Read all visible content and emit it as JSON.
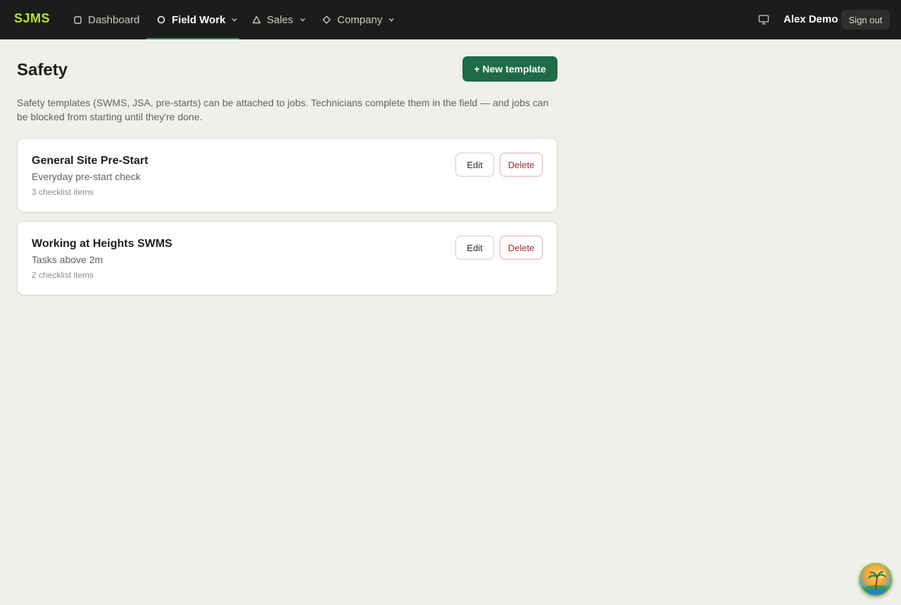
{
  "nav": {
    "brand": "SJMS",
    "items": [
      {
        "label": "Dashboard",
        "icon": "square-icon"
      },
      {
        "label": "Field Work",
        "icon": "circle-icon",
        "active": true
      },
      {
        "label": "Sales",
        "icon": "triangle-icon"
      },
      {
        "label": "Company",
        "icon": "diamond-icon"
      }
    ],
    "user_name": "Alex Demo",
    "sign_out": "Sign out",
    "monitor_icon": "monitor-icon"
  },
  "page": {
    "title": "Safety",
    "new_button": "+ New template",
    "intro": "Safety templates (SWMS, JSA, pre-starts) can be attached to jobs. Technicians complete them in the field — and jobs can be blocked from starting until they're done."
  },
  "templates": [
    {
      "title": "General Site Pre-Start",
      "subtitle": "Everyday pre-start check",
      "meta": "3 checklist items",
      "edit": "Edit",
      "delete": "Delete"
    },
    {
      "title": "Working at Heights SWMS",
      "subtitle": "Tasks above 2m",
      "meta": "2 checklist items",
      "edit": "Edit",
      "delete": "Delete"
    }
  ],
  "colors": {
    "brand": "#b9e33a",
    "primary_button": "#1e6b45",
    "nav_background": "#1b1d1a",
    "active_underline": "#2e8b57",
    "delete_text": "#9b2c2c"
  }
}
